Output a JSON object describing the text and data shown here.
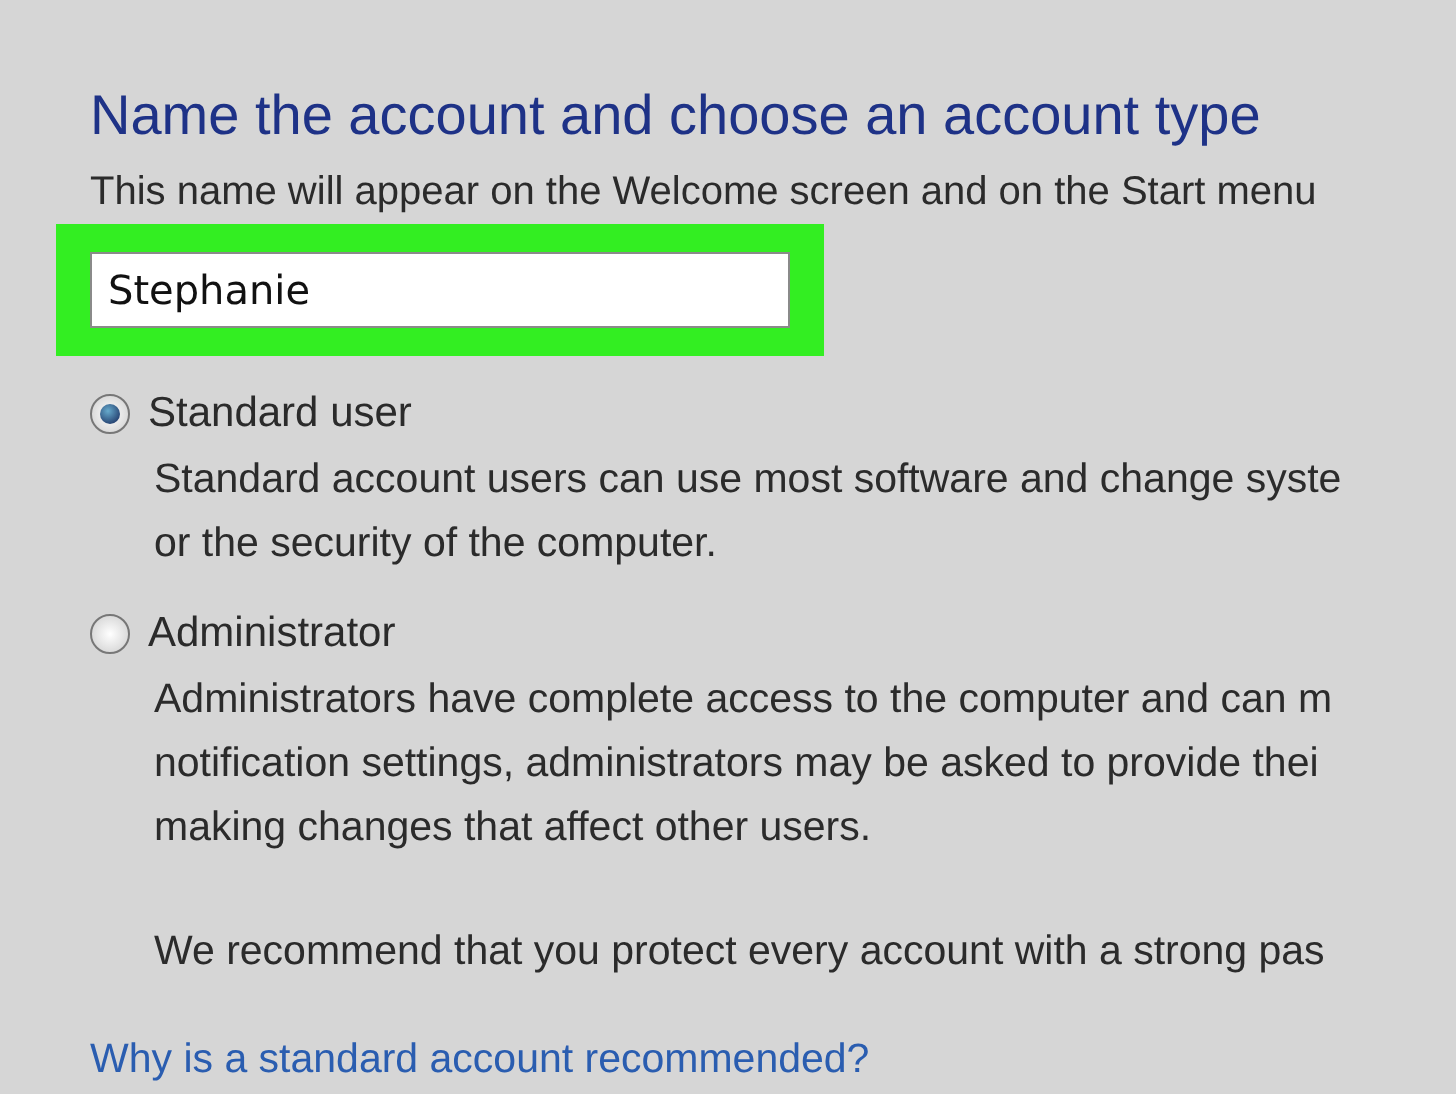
{
  "heading": "Name the account and choose an account type",
  "name_hint": "This name will appear on the Welcome screen and on the Start menu",
  "name_field": {
    "value": "Stephanie",
    "highlighted": true
  },
  "account_types": [
    {
      "label": "Standard user",
      "selected": true,
      "description": [
        "Standard account users can use most software and change syste",
        "or the security of the computer."
      ]
    },
    {
      "label": "Administrator",
      "selected": false,
      "description": [
        "Administrators have complete access to the computer and can m",
        "notification settings, administrators may be asked to provide thei",
        "making changes that affect other users."
      ]
    }
  ],
  "recommendation": "We recommend that you protect every account with a strong pas",
  "link": "Why is a standard account recommended?"
}
